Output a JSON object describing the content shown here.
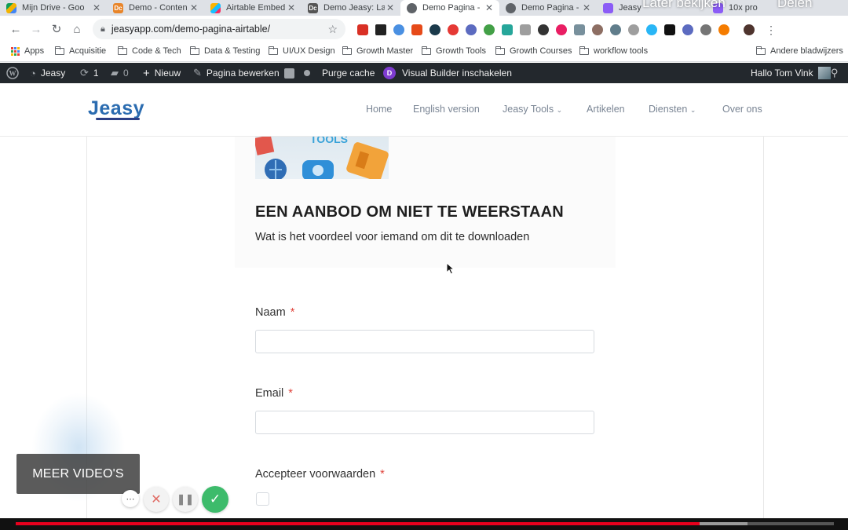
{
  "browser": {
    "tabs": [
      {
        "title": "Mijn Drive - Goo",
        "favicon": "google-drive-icon",
        "color": "#f4b400"
      },
      {
        "title": "Demo - Conten",
        "favicon": "dc-icon",
        "color": "#e8852a"
      },
      {
        "title": "Airtable Embed",
        "favicon": "airtable-icon",
        "color": "#fcb400"
      },
      {
        "title": "Demo Jeasy: La",
        "favicon": "dc-icon",
        "color": "#444"
      },
      {
        "title": "Demo Pagina -",
        "favicon": "globe-icon",
        "color": "#5f6368",
        "active": true
      },
      {
        "title": "Demo Pagina -",
        "favicon": "globe-icon",
        "color": "#5f6368"
      },
      {
        "title": "Jeasy",
        "favicon": "jeasy-icon",
        "color": "#8b5cf6"
      },
      {
        "title": "10x pro",
        "favicon": "app-icon",
        "color": "#8b5cf6"
      }
    ],
    "overlay_watch_later": "Later bekijken",
    "overlay_share": "Delen",
    "url": "jeasyapp.com/demo-pagina-airtable/"
  },
  "bookmarks": [
    {
      "label": "Apps",
      "icon": "apps-grid-icon"
    },
    {
      "label": "Acquisitie",
      "icon": "folder-icon"
    },
    {
      "label": "Code & Tech",
      "icon": "folder-icon"
    },
    {
      "label": "Data & Testing",
      "icon": "folder-icon"
    },
    {
      "label": "UI/UX Design",
      "icon": "folder-icon"
    },
    {
      "label": "Growth Master",
      "icon": "folder-icon"
    },
    {
      "label": "Growth Tools",
      "icon": "folder-icon"
    },
    {
      "label": "Growth Courses",
      "icon": "folder-icon"
    },
    {
      "label": "workflow tools",
      "icon": "folder-icon"
    },
    {
      "label": "Andere bladwijzers",
      "icon": "folder-icon"
    }
  ],
  "wp_admin": {
    "site": "Jeasy",
    "updates": "1",
    "comments": "0",
    "new": "Nieuw",
    "edit": "Pagina bewerken",
    "purge": "Purge cache",
    "visual_builder": "Visual Builder inschakelen",
    "greeting": "Hallo Tom Vink"
  },
  "site": {
    "logo_text": "Jeasy",
    "nav": [
      "Home",
      "English version",
      "Jeasy Tools",
      "Artikelen",
      "Diensten",
      "Over ons"
    ]
  },
  "offer": {
    "title": "EEN AANBOD OM NIET TE WEERSTAAN",
    "subtitle": "Wat is het voordeel voor iemand om dit te downloaden"
  },
  "form": {
    "name_label": "Naam",
    "email_label": "Email",
    "terms_label": "Accepteer voorwaarden",
    "required_mark": "*",
    "name_value": "",
    "email_value": "",
    "terms_checked": false
  },
  "video": {
    "more_videos": "MEER VIDEO'S",
    "progress_fraction": 0.836,
    "buffered_fraction": 0.894
  },
  "colors": {
    "accent_red": "#e8001d",
    "wp_bar": "#23282d",
    "confirm_green": "#3dbb6b",
    "required": "#e0443c"
  }
}
